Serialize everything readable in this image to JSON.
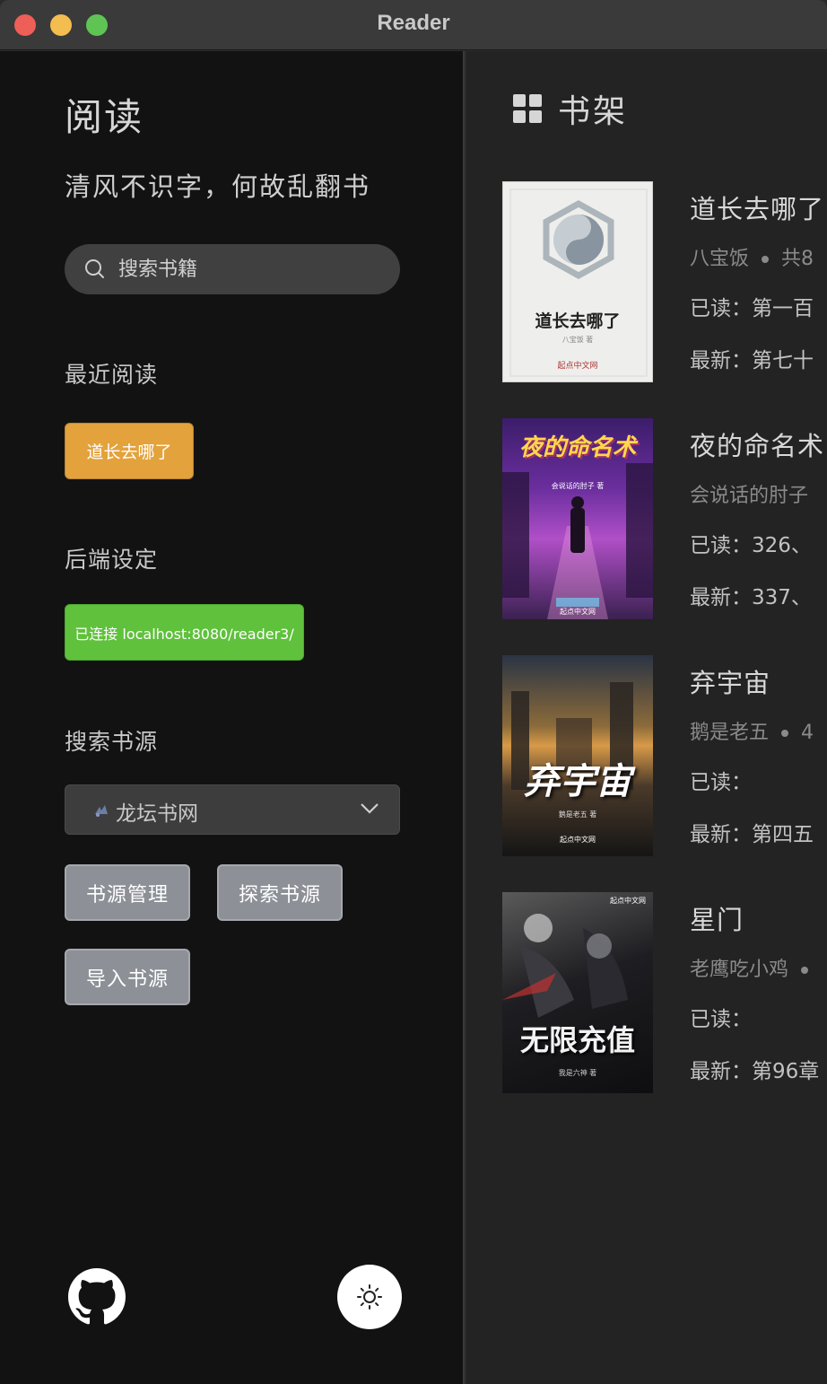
{
  "window": {
    "title": "Reader"
  },
  "sidebar": {
    "app_title": "阅读",
    "tagline": "清风不识字，何故乱翻书",
    "search_placeholder": "搜索书籍",
    "recent_heading": "最近阅读",
    "recent_book": "道长去哪了",
    "backend_heading": "后端设定",
    "connection_label": "已连接 localhost:8080/reader3/",
    "source_heading": "搜索书源",
    "source_selected": "龙坛书网",
    "buttons": {
      "manage": "书源管理",
      "explore": "探索书源",
      "import": "导入书源"
    }
  },
  "shelf": {
    "title": "书架",
    "books": [
      {
        "title": "道长去哪了",
        "author": "八宝饭",
        "meta": "共8",
        "read": "已读：第一百",
        "latest": "最新：第七十",
        "cover_title": "道长去哪了",
        "cover_author": "八宝饭 著",
        "cover_publisher": "起点中文网"
      },
      {
        "title": "夜的命名术",
        "author": "会说话的肘子",
        "meta": "",
        "read": "已读：326、",
        "latest": "最新：337、",
        "cover_title": "夜的命名术",
        "cover_author": "会说话的肘子 著",
        "cover_publisher": "起点中文网"
      },
      {
        "title": "弃宇宙",
        "author": "鹅是老五",
        "meta": "4",
        "read": "已读：",
        "latest": "最新：第四五",
        "cover_title": "弃宇宙",
        "cover_author": "鹅是老五 著",
        "cover_publisher": "起点中文网"
      },
      {
        "title": "星门",
        "author": "老鹰吃小鸡",
        "meta": "",
        "read": "已读：",
        "latest": "最新：第96章",
        "cover_title": "无限充值",
        "cover_author": "我是六神 著",
        "cover_publisher": "起点中文网"
      }
    ]
  },
  "colors": {
    "recent": "#e3a23c",
    "connected": "#5fc13c",
    "button_gray": "#8d9097"
  }
}
